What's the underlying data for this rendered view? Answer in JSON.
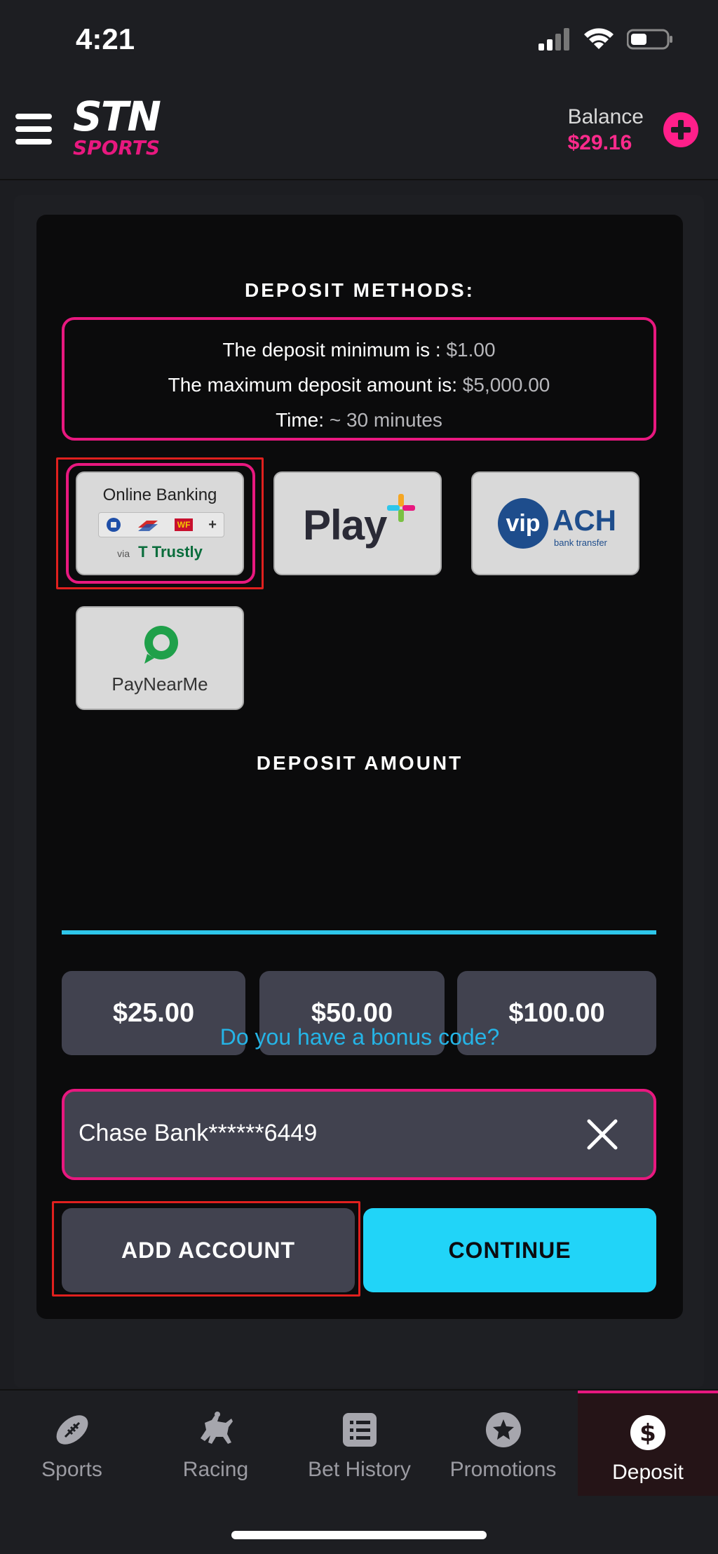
{
  "status_bar": {
    "time": "4:21"
  },
  "header": {
    "logo_top": "STN",
    "logo_bottom": "SPORTS",
    "balance_label": "Balance",
    "balance_value": "$29.16"
  },
  "deposit": {
    "methods_heading": "DEPOSIT METHODS:",
    "info": {
      "min_label": "The deposit minimum is :",
      "min_value": "$1.00",
      "max_label": "The maximum deposit amount is:",
      "max_value": "$5,000.00",
      "time_label": "Time:",
      "time_value": "~ 30 minutes"
    },
    "methods": [
      {
        "title": "Online Banking",
        "via": "via",
        "brand": "Trustly",
        "bank_badges": [
          "WF",
          "+"
        ]
      },
      {
        "title": "Play",
        "symbol": "+"
      },
      {
        "title": "vip",
        "subtitle": "ACH",
        "caption": "bank transfer"
      },
      {
        "title": "PayNearMe"
      }
    ],
    "amount_heading": "DEPOSIT AMOUNT",
    "quick_amounts": [
      "$25.00",
      "$50.00",
      "$100.00"
    ],
    "bonus_link": "Do you have a bonus code?",
    "account": "Chase Bank******6449",
    "add_account_label": "ADD ACCOUNT",
    "continue_label": "CONTINUE"
  },
  "nav": {
    "items": [
      {
        "label": "Sports",
        "icon": "football-icon"
      },
      {
        "label": "Racing",
        "icon": "horse-racing-icon"
      },
      {
        "label": "Bet History",
        "icon": "list-icon"
      },
      {
        "label": "Promotions",
        "icon": "star-icon"
      },
      {
        "label": "Deposit",
        "icon": "dollar-icon"
      }
    ],
    "active": "Deposit"
  },
  "colors": {
    "brand_pink": "#e8187f",
    "accent_cyan": "#21d4f8",
    "link_blue": "#25b4e6"
  }
}
